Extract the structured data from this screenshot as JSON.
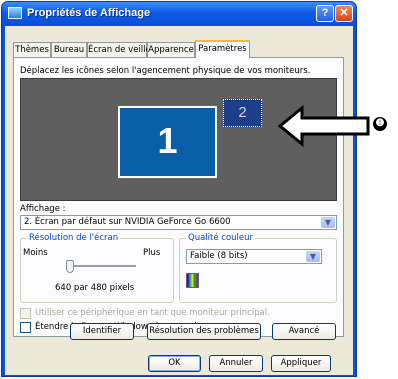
{
  "window": {
    "title": "Propriétés de Affichage",
    "help_label": "?",
    "close_label": "✕"
  },
  "tabs": [
    {
      "label": "Thèmes",
      "active": false
    },
    {
      "label": "Bureau",
      "active": false
    },
    {
      "label": "Écran de veille",
      "active": false
    },
    {
      "label": "Apparence",
      "active": false
    },
    {
      "label": "Paramètres",
      "active": true
    }
  ],
  "settings": {
    "description": "Déplacez les icônes selon l'agencement physique de vos moniteurs.",
    "monitors": [
      {
        "label": "1",
        "selected": false
      },
      {
        "label": "2",
        "selected": true
      }
    ],
    "display_label": "Affichage :",
    "display_value": "2. Écran par défaut sur NVIDIA GeForce Go 6600",
    "resolution": {
      "group_label": "Résolution de l'écran",
      "min_label": "Moins",
      "max_label": "Plus",
      "value": "640 par 480 pixels",
      "slider_position": 0.0
    },
    "color_quality": {
      "group_label": "Qualité couleur",
      "value": "Faible (8 bits)"
    },
    "primary_monitor_label": "Utiliser ce périphérique en tant que moniteur principal.",
    "extend_desktop_label": "Étendre le Bureau Windows à ce moniteur.",
    "buttons": {
      "identify": "Identifier",
      "troubleshoot": "Résolution des problèmes",
      "advanced": "Avancé"
    }
  },
  "dialog_buttons": {
    "ok": "OK",
    "cancel": "Annuler",
    "apply": "Appliquer"
  },
  "annotation": {
    "badge_label": "❶"
  },
  "colors": {
    "titlebar": "#0a53d8",
    "monitor_primary": "#0b5ea8",
    "monitor_area": "#5f5f5f"
  }
}
